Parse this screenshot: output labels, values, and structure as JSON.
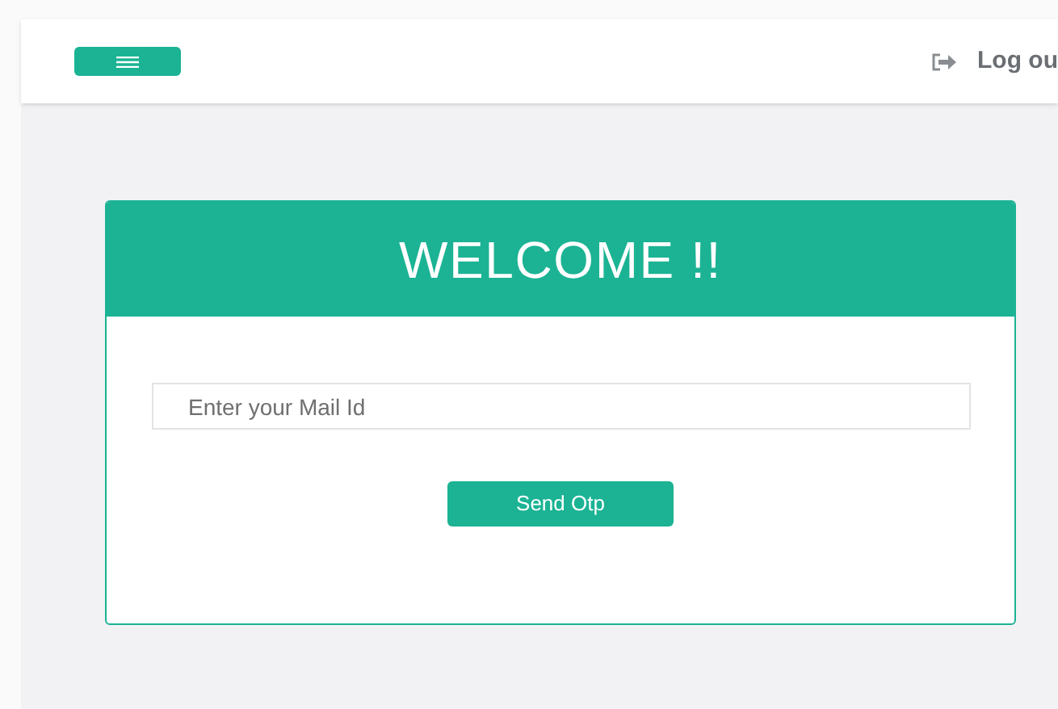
{
  "header": {
    "logout": "Log ou"
  },
  "card": {
    "title": "WELCOME !!",
    "email": {
      "placeholder": "Enter your Mail Id"
    },
    "button": "Send Otp"
  }
}
